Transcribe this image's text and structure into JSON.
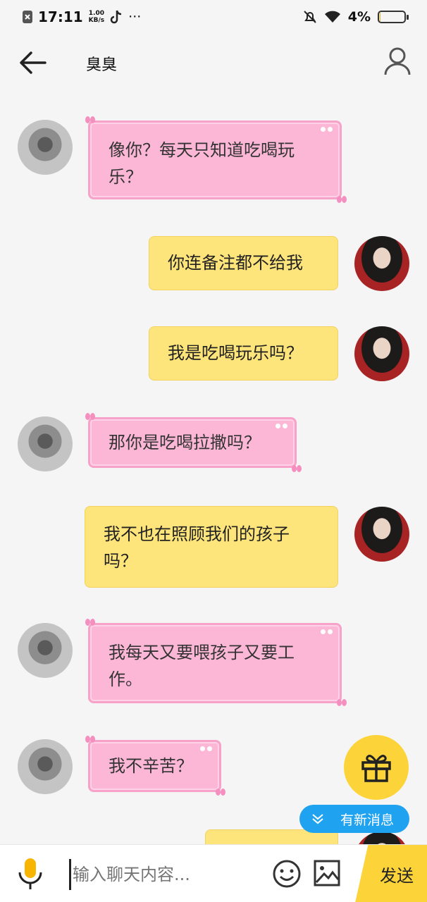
{
  "status_bar": {
    "time": "17:11",
    "net_speed_value": "1.00",
    "net_speed_unit": "KB/s",
    "more": "···",
    "battery_percent": "4%",
    "battery_level": 0.04
  },
  "header": {
    "title": "臭臭"
  },
  "messages": [
    {
      "side": "other",
      "text": "像你？每天只知道吃喝玩乐？"
    },
    {
      "side": "me",
      "text": "你连备注都不给我"
    },
    {
      "side": "me",
      "text": "我是吃喝玩乐吗？"
    },
    {
      "side": "other",
      "text": "那你是吃喝拉撒吗？"
    },
    {
      "side": "me",
      "text": "我不也在照顾我们的孩子吗？"
    },
    {
      "side": "other",
      "text": "我每天又要喂孩子又要工作。"
    },
    {
      "side": "other",
      "text": "我不辛苦？"
    }
  ],
  "new_message_badge": "有新消息",
  "input": {
    "placeholder": "输入聊天内容...",
    "send_label": "发送"
  },
  "colors": {
    "pink_bubble": "#fdb7d6",
    "yellow_bubble": "#fde47b",
    "accent": "#fcd43a",
    "badge_blue": "#1fa3f0"
  }
}
